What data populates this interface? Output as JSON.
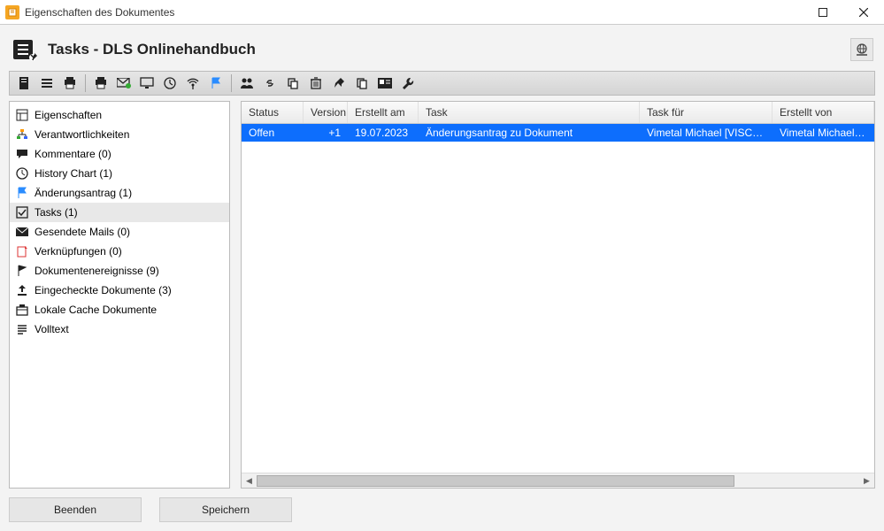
{
  "titlebar": {
    "text": "Eigenschaften des Dokumentes"
  },
  "header": {
    "title": "Tasks - DLS Onlinehandbuch"
  },
  "sidebar": {
    "items": [
      {
        "label": "Eigenschaften"
      },
      {
        "label": "Verantwortlichkeiten"
      },
      {
        "label": "Kommentare (0)"
      },
      {
        "label": "History Chart (1)"
      },
      {
        "label": "Änderungsantrag (1)"
      },
      {
        "label": "Tasks (1)"
      },
      {
        "label": "Gesendete Mails (0)"
      },
      {
        "label": "Verknüpfungen (0)"
      },
      {
        "label": "Dokumentenereignisse (9)"
      },
      {
        "label": "Eingecheckte Dokumente (3)"
      },
      {
        "label": "Lokale Cache Dokumente"
      },
      {
        "label": "Volltext"
      }
    ],
    "selected_index": 5
  },
  "table": {
    "columns": [
      "Status",
      "Version",
      "Erstellt am",
      "Task",
      "Task für",
      "Erstellt von"
    ],
    "rows": [
      {
        "status": "Offen",
        "version": "+1",
        "erstellt_am": "19.07.2023",
        "task": "Änderungsantrag zu Dokument",
        "task_fuer": "Vimetal Michael [VISCOM]",
        "erstellt_von": "Vimetal Michael [VI"
      }
    ]
  },
  "footer": {
    "beenden_label": "Beenden",
    "speichern_label": "Speichern"
  }
}
